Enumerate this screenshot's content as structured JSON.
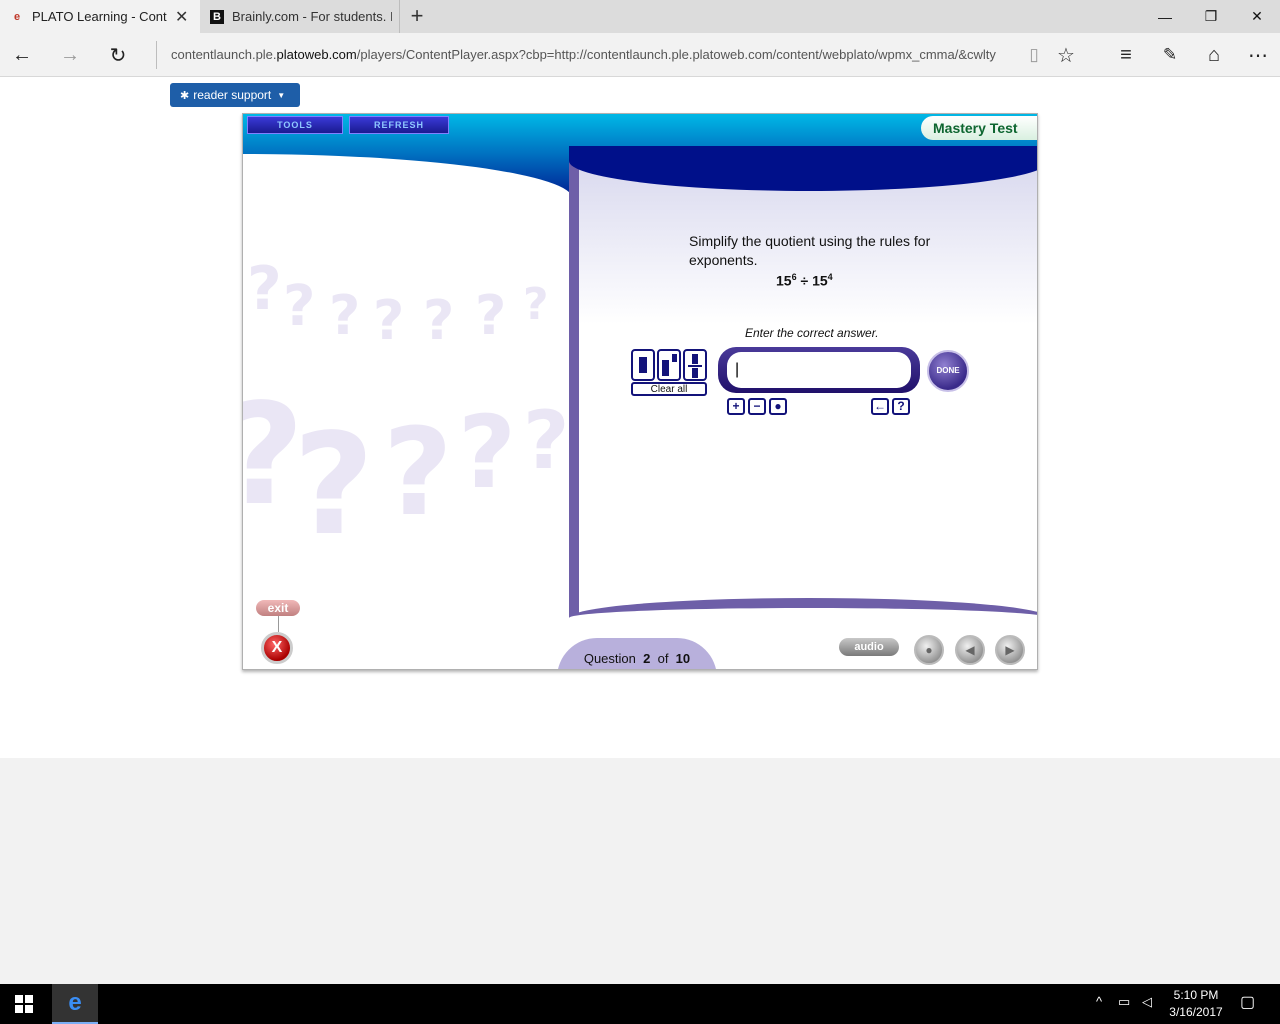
{
  "browser": {
    "tabs": [
      {
        "title": "PLATO Learning - Conte",
        "favicon": "e",
        "active": true
      },
      {
        "title": "Brainly.com - For students. I",
        "favicon": "B",
        "active": false
      }
    ],
    "address": {
      "prefix": "contentlaunch.ple.",
      "host": "platoweb.com",
      "rest": "/players/ContentPlayer.aspx?cbp=http://contentlaunch.ple.platoweb.com/content/webplato/wpmx_cmma/&cwlty"
    }
  },
  "reader_support": {
    "label": "reader support"
  },
  "player": {
    "toolbar": {
      "tools_label": "TOOLS",
      "refresh_label": "REFRESH"
    },
    "badge": "Mastery Test",
    "question": {
      "prompt": "Simplify the quotient using the rules for exponents.",
      "base1": "15",
      "exp1": "6",
      "operator": "÷",
      "base2": "15",
      "exp2": "4",
      "instruction": "Enter the correct answer.",
      "answer_value": "|"
    },
    "editor": {
      "clear_all_label": "Clear all",
      "done_label": "DONE",
      "symbols": [
        "+",
        "−",
        "●"
      ],
      "utility": [
        "←",
        "?"
      ]
    },
    "exit_label": "exit",
    "exit_icon": "X",
    "counter": {
      "prefix": "Question",
      "current": "2",
      "of": "of",
      "total": "10"
    },
    "audio_label": "audio"
  },
  "taskbar": {
    "time": "5:10 PM",
    "date": "3/16/2017"
  }
}
